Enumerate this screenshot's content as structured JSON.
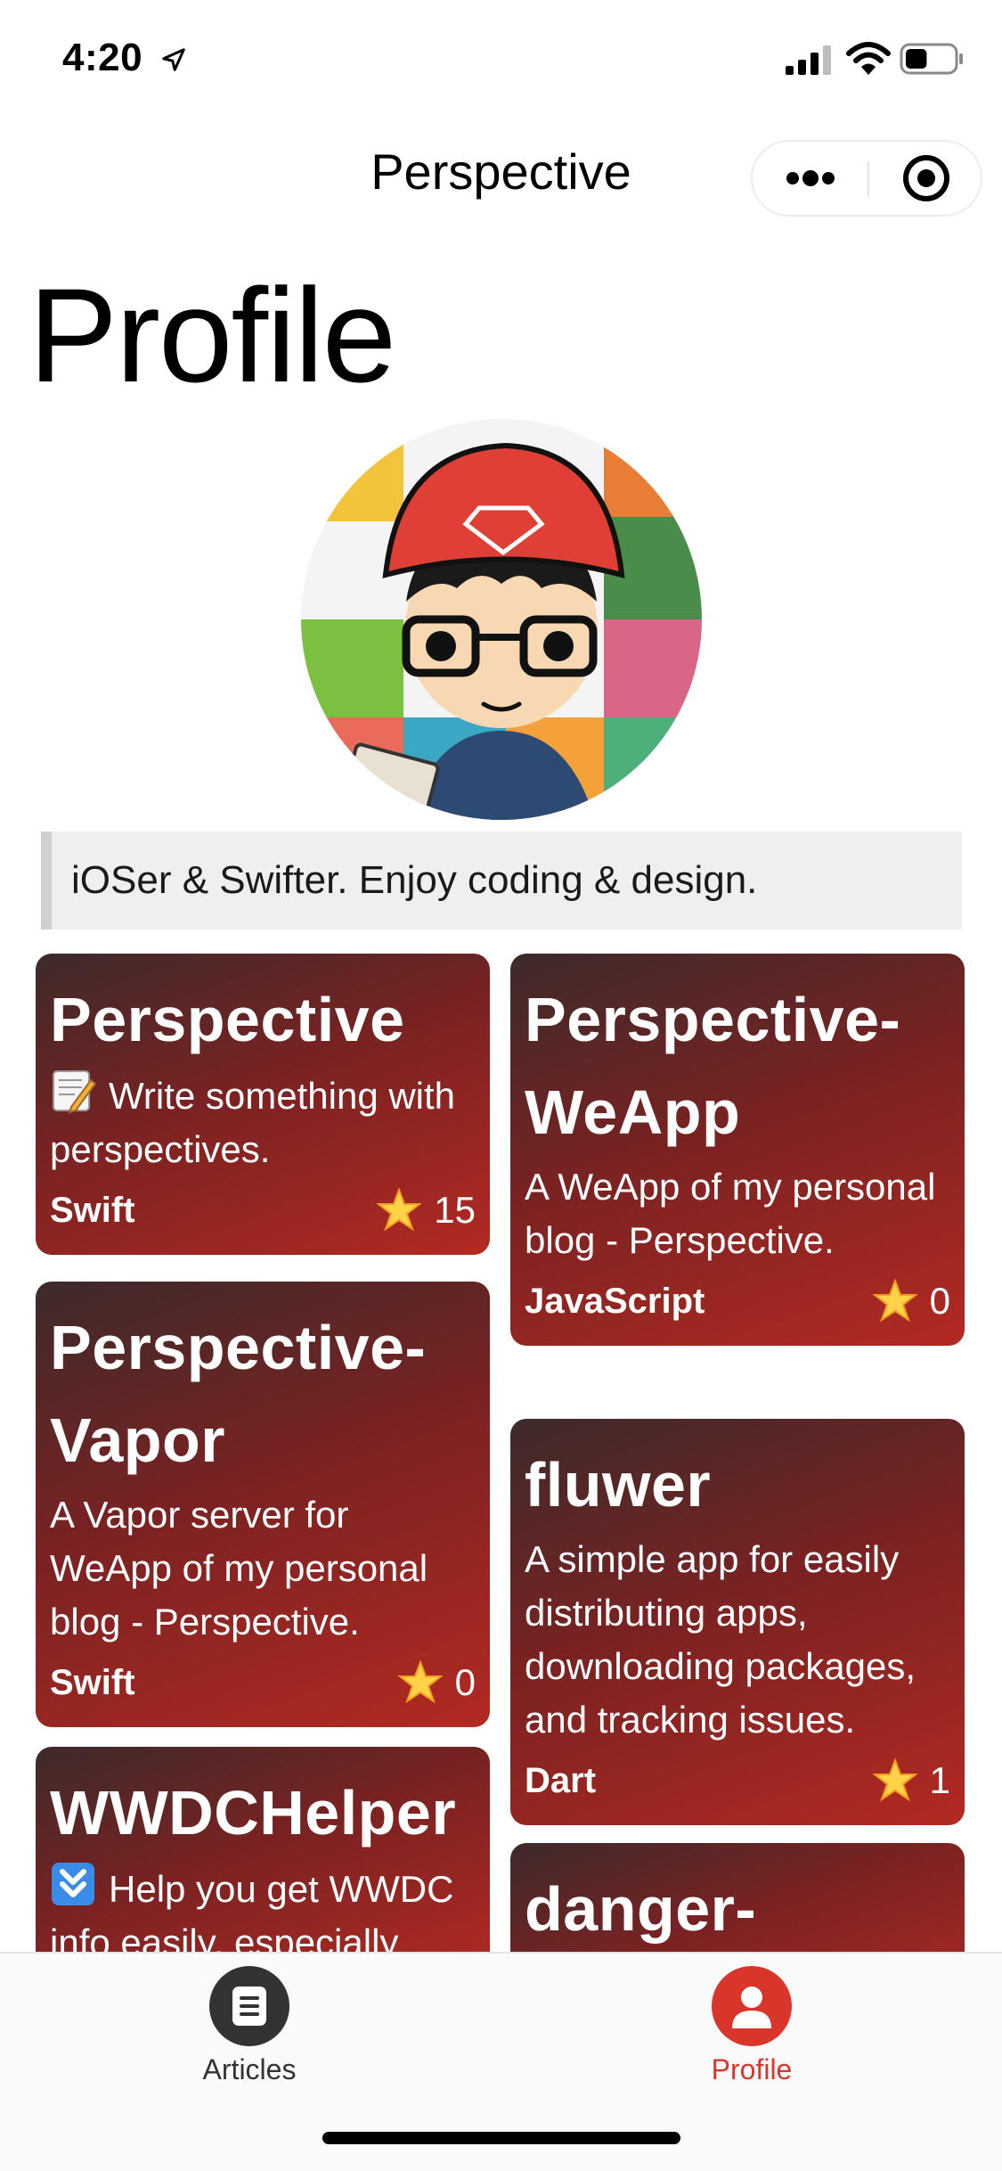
{
  "status_bar": {
    "time": "4:20",
    "battery_level": 0.45
  },
  "nav": {
    "title": "Perspective",
    "more_icon": "more-dots-icon",
    "close_icon": "target-close-icon"
  },
  "page": {
    "title": "Profile"
  },
  "profile": {
    "bio": "iOSer & Swifter. Enjoy coding & design."
  },
  "repos": [
    {
      "name": "Perspective",
      "emoji": "memo-emoji",
      "description": "Write something with perspectives.",
      "language": "Swift",
      "stars": "15"
    },
    {
      "name_line1": "Perspective-",
      "name_line2": "WeApp",
      "description": "A WeApp of my personal blog - Perspective.",
      "language": "JavaScript",
      "stars": "0"
    },
    {
      "name_line1": "Perspective-",
      "name_line2": "Vapor",
      "description": "A Vapor server for WeApp of my personal blog - Perspective.",
      "language": "Swift",
      "stars": "0"
    },
    {
      "name": "fluwer",
      "description": "A simple app for easily distributing apps, downloading packages, and tracking issues.",
      "language": "Dart",
      "stars": "1"
    },
    {
      "name": "WWDCHelper",
      "emoji": "down-arrow-emoji",
      "description": "Help you get WWDC info easily, especially"
    },
    {
      "name": "danger-"
    }
  ],
  "tabs": [
    {
      "label": "Articles",
      "icon": "article-icon",
      "active": false
    },
    {
      "label": "Profile",
      "icon": "person-icon",
      "active": true
    }
  ],
  "colors": {
    "accent": "#d9352a",
    "card_dark": "#3d2a2a",
    "card_red": "#b22a22",
    "inactive_tab": "#333333"
  }
}
